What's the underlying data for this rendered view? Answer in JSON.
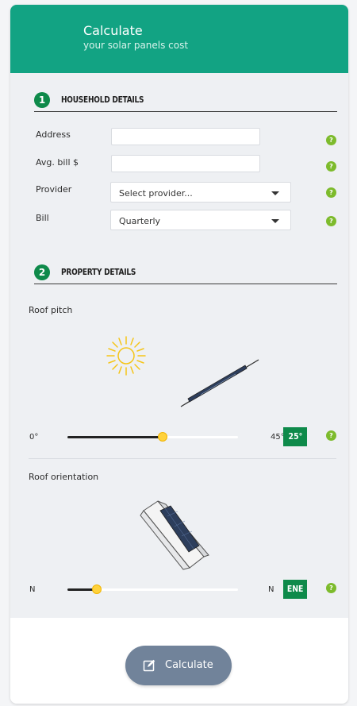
{
  "header": {
    "title": "Calculate",
    "subtitle": "your solar panels cost"
  },
  "sections": {
    "household": {
      "number": "1",
      "title": "HOUSEHOLD DETAILS",
      "fields": {
        "address": {
          "label": "Address",
          "value": "",
          "placeholder": ""
        },
        "bill_amount": {
          "label": "Avg. bill $",
          "value": "",
          "placeholder": ""
        },
        "provider": {
          "label": "Provider",
          "value": "Select provider..."
        },
        "bill": {
          "label": "Bill",
          "value": "Quarterly"
        }
      },
      "help_glyph": "?"
    },
    "property": {
      "number": "2",
      "title": "PROPERTY DETAILS",
      "roof_pitch": {
        "label": "Roof pitch",
        "min_label": "0°",
        "max_label": "45°",
        "value_label": "25°",
        "fraction": 0.56
      },
      "roof_orientation": {
        "label": "Roof orientation",
        "min_label": "N",
        "max_label": "N",
        "value_label": "ENE",
        "fraction": 0.17
      }
    }
  },
  "footer": {
    "calculate_label": "Calculate"
  },
  "colors": {
    "header": "#12a383",
    "step_badge": "#0e8a4a",
    "help": "#7dbb2c",
    "button": "#71839a",
    "slider_thumb": "#ffd23c"
  },
  "icons": [
    "sun-icon",
    "tilted-panel-icon",
    "roof-orientation-icon",
    "edit-icon",
    "help-icon"
  ]
}
